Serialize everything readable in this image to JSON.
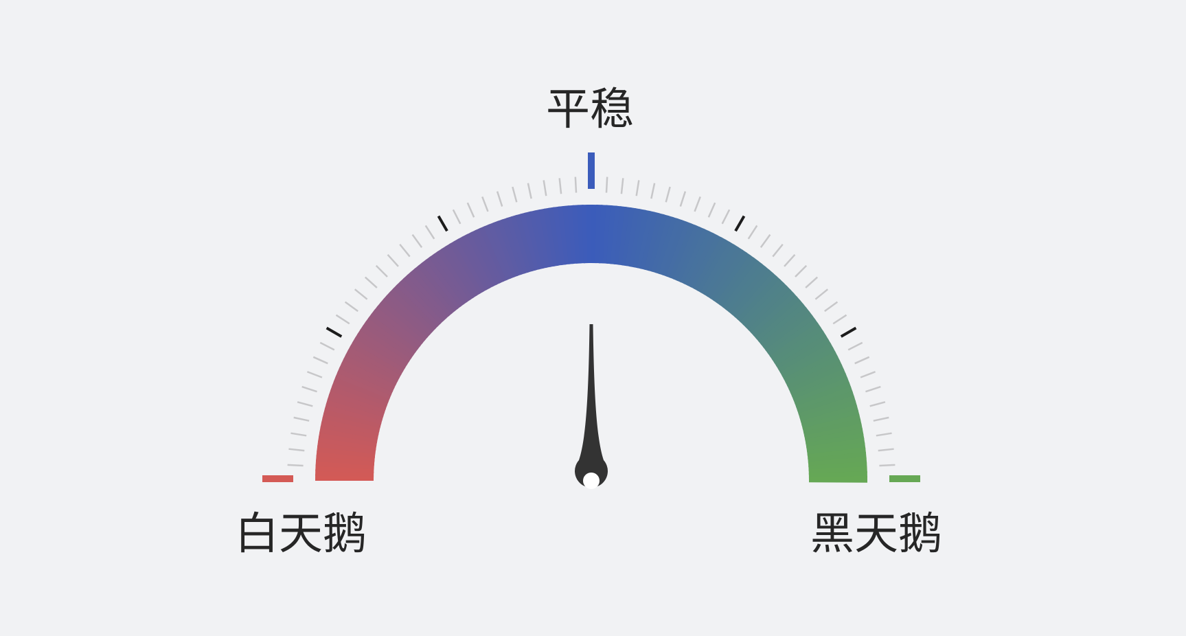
{
  "gauge": {
    "left_label": "白天鹅",
    "center_label": "平稳",
    "right_label": "黑天鹅",
    "value": 0.5,
    "colors": {
      "left": "#d45a55",
      "center": "#3b5cbb",
      "right": "#66a854",
      "tick_minor": "#c7c7c9",
      "tick_major": "#1c1c1c",
      "needle": "#333333",
      "background": "#f1f2f4"
    }
  }
}
